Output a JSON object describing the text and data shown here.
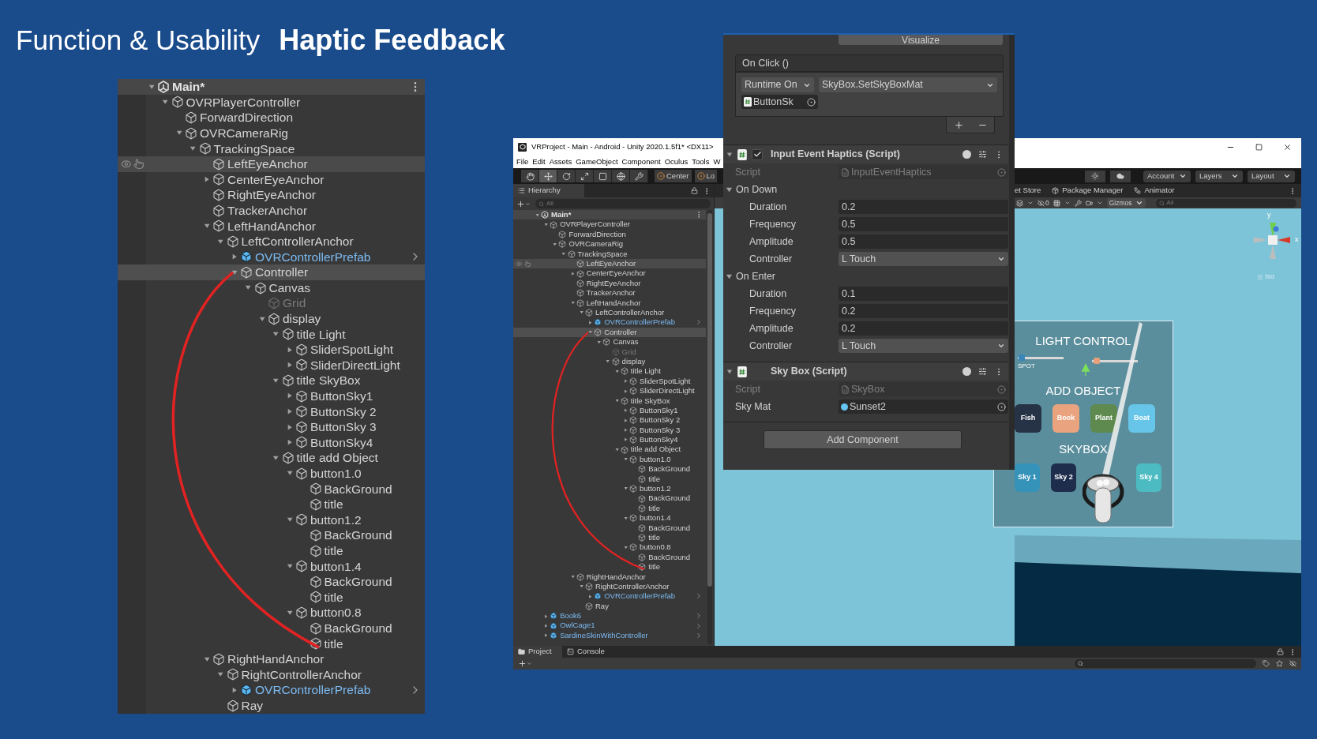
{
  "slide": {
    "title_light": "Function & Usability",
    "title_bold": "Haptic Feedback"
  },
  "zoomed_hierarchy": {
    "tree": [
      {
        "name": "Main*",
        "kind": "scene",
        "expanded": true,
        "children": [
          {
            "name": "OVRPlayerController",
            "kind": "object",
            "expanded": true,
            "selected": false,
            "children": [
              {
                "name": "ForwardDirection",
                "kind": "object",
                "selected": false
              },
              {
                "name": "OVRCameraRig",
                "kind": "object",
                "expanded": true,
                "selected": false,
                "children": [
                  {
                    "name": "TrackingSpace",
                    "kind": "object",
                    "expanded": true,
                    "selected": false,
                    "children": [
                      {
                        "name": "LeftEyeAnchor",
                        "kind": "object",
                        "selected": false,
                        "hovered": true
                      },
                      {
                        "name": "CenterEyeAnchor",
                        "kind": "object",
                        "expanded": false,
                        "selected": false
                      },
                      {
                        "name": "RightEyeAnchor",
                        "kind": "object",
                        "selected": false
                      },
                      {
                        "name": "TrackerAnchor",
                        "kind": "object",
                        "selected": false
                      },
                      {
                        "name": "LeftHandAnchor",
                        "kind": "object",
                        "expanded": true,
                        "selected": false,
                        "children": [
                          {
                            "name": "LeftControllerAnchor",
                            "kind": "object",
                            "expanded": true,
                            "selected": false,
                            "children": [
                              {
                                "name": "OVRControllerPrefab",
                                "kind": "prefab",
                                "expanded": false,
                                "selected": false
                              },
                              {
                                "name": "Controller",
                                "kind": "object",
                                "expanded": true,
                                "selected": true,
                                "children": [
                                  {
                                    "name": "Canvas",
                                    "kind": "object",
                                    "expanded": true,
                                    "selected": false,
                                    "children": [
                                      {
                                        "name": "Grid",
                                        "kind": "inactive",
                                        "selected": false
                                      },
                                      {
                                        "name": "display",
                                        "kind": "object",
                                        "expanded": true,
                                        "selected": false,
                                        "children": [
                                          {
                                            "name": "title Light",
                                            "kind": "object",
                                            "expanded": true,
                                            "selected": false,
                                            "children": [
                                              {
                                                "name": "SliderSpotLight",
                                                "kind": "object",
                                                "expanded": false,
                                                "selected": false
                                              },
                                              {
                                                "name": "SliderDirectLight",
                                                "kind": "object",
                                                "expanded": false,
                                                "selected": false
                                              }
                                            ]
                                          },
                                          {
                                            "name": "title SkyBox",
                                            "kind": "object",
                                            "expanded": true,
                                            "selected": false,
                                            "children": [
                                              {
                                                "name": "ButtonSky1",
                                                "kind": "object",
                                                "expanded": false,
                                                "selected": false
                                              },
                                              {
                                                "name": "ButtonSky 2",
                                                "kind": "object",
                                                "expanded": false,
                                                "selected": false
                                              },
                                              {
                                                "name": "ButtonSky 3",
                                                "kind": "object",
                                                "expanded": false,
                                                "selected": false
                                              },
                                              {
                                                "name": "ButtonSky4",
                                                "kind": "object",
                                                "expanded": false,
                                                "selected": false
                                              }
                                            ]
                                          },
                                          {
                                            "name": "title add Object",
                                            "kind": "object",
                                            "expanded": true,
                                            "selected": false,
                                            "children": [
                                              {
                                                "name": "button1.0",
                                                "kind": "object",
                                                "expanded": true,
                                                "selected": false,
                                                "children": [
                                                  {
                                                    "name": "BackGround",
                                                    "kind": "object",
                                                    "selected": false
                                                  },
                                                  {
                                                    "name": "title",
                                                    "kind": "object",
                                                    "selected": false
                                                  }
                                                ]
                                              },
                                              {
                                                "name": "button1.2",
                                                "kind": "object",
                                                "expanded": true,
                                                "selected": false,
                                                "children": [
                                                  {
                                                    "name": "BackGround",
                                                    "kind": "object",
                                                    "selected": false
                                                  },
                                                  {
                                                    "name": "title",
                                                    "kind": "object",
                                                    "selected": false
                                                  }
                                                ]
                                              },
                                              {
                                                "name": "button1.4",
                                                "kind": "object",
                                                "expanded": true,
                                                "selected": false,
                                                "children": [
                                                  {
                                                    "name": "BackGround",
                                                    "kind": "object",
                                                    "selected": false
                                                  },
                                                  {
                                                    "name": "title",
                                                    "kind": "object",
                                                    "selected": false
                                                  }
                                                ]
                                              },
                                              {
                                                "name": "button0.8",
                                                "kind": "object",
                                                "expanded": true,
                                                "selected": false,
                                                "children": [
                                                  {
                                                    "name": "BackGround",
                                                    "kind": "object",
                                                    "selected": false
                                                  },
                                                  {
                                                    "name": "title",
                                                    "kind": "object",
                                                    "selected": false
                                                  }
                                                ]
                                              }
                                            ]
                                          }
                                        ]
                                      }
                                    ]
                                  }
                                ]
                              }
                            ]
                          }
                        ]
                      },
                      {
                        "name": "RightHandAnchor",
                        "kind": "object",
                        "expanded": true,
                        "selected": false,
                        "children": [
                          {
                            "name": "RightControllerAnchor",
                            "kind": "object",
                            "expanded": true,
                            "selected": false,
                            "children": [
                              {
                                "name": "OVRControllerPrefab",
                                "kind": "prefab",
                                "expanded": false,
                                "selected": false
                              }
                            ]
                          },
                          {
                            "name": "Ray",
                            "kind": "object",
                            "selected": false
                          }
                        ]
                      }
                    ]
                  }
                ]
              }
            ]
          }
        ]
      }
    ]
  },
  "unity_window": {
    "title": "VRProject - Main - Android - Unity 2020.1.5f1* <DX11>",
    "menu": [
      "File",
      "Edit",
      "Assets",
      "GameObject",
      "Component",
      "Oculus",
      "Tools",
      "W"
    ],
    "tools": [
      {
        "kind": "hand",
        "selected": false
      },
      {
        "kind": "move",
        "selected": true
      },
      {
        "kind": "rotate",
        "selected": false
      },
      {
        "kind": "scale",
        "selected": false
      },
      {
        "kind": "rect",
        "selected": false
      },
      {
        "kind": "transform",
        "selected": false
      },
      {
        "kind": "custom",
        "selected": false
      }
    ],
    "pivot_buttons": [
      "Center",
      "Lo"
    ],
    "top_right_menus": [
      "Account",
      "Layers",
      "Layout"
    ],
    "scene_tabs": [
      "et Store",
      "Package Manager",
      "Animator"
    ],
    "scene_toolbar": {
      "hidden_count": "0",
      "gizmos": "Gizmos",
      "search_placeholder": "All"
    },
    "hierarchy": {
      "title": "Hierarchy",
      "search_placeholder": "All",
      "tree": [
        {
          "name": "Main*",
          "kind": "scene",
          "expanded": true,
          "children": [
            {
              "name": "OVRPlayerController",
              "kind": "object",
              "expanded": true,
              "selected": false,
              "children": [
                {
                  "name": "ForwardDirection",
                  "kind": "object",
                  "selected": false
                },
                {
                  "name": "OVRCameraRig",
                  "kind": "object",
                  "expanded": true,
                  "selected": false,
                  "children": [
                    {
                      "name": "TrackingSpace",
                      "kind": "object",
                      "expanded": true,
                      "selected": false,
                      "children": [
                        {
                          "name": "LeftEyeAnchor",
                          "kind": "object",
                          "selected": false,
                          "hovered": true
                        },
                        {
                          "name": "CenterEyeAnchor",
                          "kind": "object",
                          "expanded": false,
                          "selected": false
                        },
                        {
                          "name": "RightEyeAnchor",
                          "kind": "object",
                          "selected": false
                        },
                        {
                          "name": "TrackerAnchor",
                          "kind": "object",
                          "selected": false
                        },
                        {
                          "name": "LeftHandAnchor",
                          "kind": "object",
                          "expanded": true,
                          "selected": false,
                          "children": [
                            {
                              "name": "LeftControllerAnchor",
                              "kind": "object",
                              "expanded": true,
                              "selected": false,
                              "children": [
                                {
                                  "name": "OVRControllerPrefab",
                                  "kind": "prefab",
                                  "expanded": false,
                                  "selected": false
                                },
                                {
                                  "name": "Controller",
                                  "kind": "object",
                                  "expanded": true,
                                  "selected": true,
                                  "children": [
                                    {
                                      "name": "Canvas",
                                      "kind": "object",
                                      "expanded": true,
                                      "selected": false,
                                      "children": [
                                        {
                                          "name": "Grid",
                                          "kind": "inactive",
                                          "selected": false
                                        },
                                        {
                                          "name": "display",
                                          "kind": "object",
                                          "expanded": true,
                                          "selected": false,
                                          "children": [
                                            {
                                              "name": "title Light",
                                              "kind": "object",
                                              "expanded": true,
                                              "selected": false,
                                              "children": [
                                                {
                                                  "name": "SliderSpotLight",
                                                  "kind": "object",
                                                  "expanded": false,
                                                  "selected": false
                                                },
                                                {
                                                  "name": "SliderDirectLight",
                                                  "kind": "object",
                                                  "expanded": false,
                                                  "selected": false
                                                }
                                              ]
                                            },
                                            {
                                              "name": "title SkyBox",
                                              "kind": "object",
                                              "expanded": true,
                                              "selected": false,
                                              "children": [
                                                {
                                                  "name": "ButtonSky1",
                                                  "kind": "object",
                                                  "expanded": false,
                                                  "selected": false
                                                },
                                                {
                                                  "name": "ButtonSky 2",
                                                  "kind": "object",
                                                  "expanded": false,
                                                  "selected": false
                                                },
                                                {
                                                  "name": "ButtonSky 3",
                                                  "kind": "object",
                                                  "expanded": false,
                                                  "selected": false
                                                },
                                                {
                                                  "name": "ButtonSky4",
                                                  "kind": "object",
                                                  "expanded": false,
                                                  "selected": false
                                                }
                                              ]
                                            },
                                            {
                                              "name": "title add Object",
                                              "kind": "object",
                                              "expanded": true,
                                              "selected": false,
                                              "children": [
                                                {
                                                  "name": "button1.0",
                                                  "kind": "object",
                                                  "expanded": true,
                                                  "selected": false,
                                                  "children": [
                                                    {
                                                      "name": "BackGround",
                                                      "kind": "object",
                                                      "selected": false
                                                    },
                                                    {
                                                      "name": "title",
                                                      "kind": "object",
                                                      "selected": false
                                                    }
                                                  ]
                                                },
                                                {
                                                  "name": "button1.2",
                                                  "kind": "object",
                                                  "expanded": true,
                                                  "selected": false,
                                                  "children": [
                                                    {
                                                      "name": "BackGround",
                                                      "kind": "object",
                                                      "selected": false
                                                    },
                                                    {
                                                      "name": "title",
                                                      "kind": "object",
                                                      "selected": false
                                                    }
                                                  ]
                                                },
                                                {
                                                  "name": "button1.4",
                                                  "kind": "object",
                                                  "expanded": true,
                                                  "selected": false,
                                                  "children": [
                                                    {
                                                      "name": "BackGround",
                                                      "kind": "object",
                                                      "selected": false
                                                    },
                                                    {
                                                      "name": "title",
                                                      "kind": "object",
                                                      "selected": false
                                                    }
                                                  ]
                                                },
                                                {
                                                  "name": "button0.8",
                                                  "kind": "object",
                                                  "expanded": true,
                                                  "selected": false,
                                                  "children": [
                                                    {
                                                      "name": "BackGround",
                                                      "kind": "object",
                                                      "selected": false
                                                    },
                                                    {
                                                      "name": "title",
                                                      "kind": "object",
                                                      "selected": false
                                                    }
                                                  ]
                                                }
                                              ]
                                            }
                                          ]
                                        }
                                      ]
                                    }
                                  ]
                                }
                              ]
                            }
                          ]
                        },
                        {
                          "name": "RightHandAnchor",
                          "kind": "object",
                          "expanded": true,
                          "selected": false,
                          "children": [
                            {
                              "name": "RightControllerAnchor",
                              "kind": "object",
                              "expanded": true,
                              "selected": false,
                              "children": [
                                {
                                  "name": "OVRControllerPrefab",
                                  "kind": "prefab",
                                  "expanded": false,
                                  "selected": false
                                }
                              ]
                            },
                            {
                              "name": "Ray",
                              "kind": "object",
                              "selected": false
                            }
                          ]
                        }
                      ]
                    }
                  ]
                }
              ]
            },
            {
              "name": "Book6",
              "kind": "prefab",
              "expanded": false,
              "selected": false
            },
            {
              "name": "OwlCage1",
              "kind": "prefab",
              "expanded": false,
              "selected": false
            },
            {
              "name": "SardineSkinWithController",
              "kind": "prefab",
              "expanded": false,
              "selected": false
            }
          ]
        }
      ]
    },
    "scene": {
      "gizmo_labels": [
        "y",
        "x"
      ],
      "view_mode": "Iso",
      "panel": {
        "light_title": "LIGHT CONTROL",
        "sliders": [
          {
            "label": "SPOT",
            "level": 0.02
          },
          {
            "level": 0.03
          }
        ],
        "object_title": "ADD OBJECT",
        "object_tiles": [
          {
            "label": "Fish",
            "color": "#263246"
          },
          {
            "label": "Book",
            "color": "#e9a37e"
          },
          {
            "label": "Plant",
            "color": "#5e8a4f"
          },
          {
            "label": "Boat",
            "color": "#66c5e8"
          }
        ],
        "skybox_title": "SKYBOX",
        "sky_tiles": [
          {
            "label": "Sky 1",
            "color": "#3592b8"
          },
          {
            "label": "Sky 2",
            "color": "#1f2d4d"
          },
          {
            "label": "Sky 4",
            "color": "#4dbcc2"
          }
        ]
      }
    },
    "bottom_tabs": [
      {
        "label": "Project",
        "selected": true
      },
      {
        "label": "Console",
        "selected": false
      }
    ]
  },
  "inspector": {
    "visualize": "Visualize",
    "event": {
      "title": "On Click ()",
      "mode": "Runtime On",
      "function": "SkyBox.SetSkyBoxMat",
      "target": "ButtonSk"
    },
    "components": [
      {
        "title": "Input Event Haptics (Script)",
        "enabled": true,
        "script_label": "Script",
        "script": "InputEventHaptics",
        "groups": [
          {
            "title": "On Down",
            "expanded": true,
            "fields": [
              {
                "label": "Duration",
                "value": "0.2",
                "kind": "number"
              },
              {
                "label": "Frequency",
                "value": "0.5",
                "kind": "number"
              },
              {
                "label": "Amplitude",
                "value": "0.5",
                "kind": "number"
              },
              {
                "label": "Controller",
                "value": "L Touch",
                "kind": "dropdown"
              }
            ]
          },
          {
            "title": "On Enter",
            "expanded": true,
            "fields": [
              {
                "label": "Duration",
                "value": "0.1",
                "kind": "number"
              },
              {
                "label": "Frequency",
                "value": "0.2",
                "kind": "number"
              },
              {
                "label": "Amplitude",
                "value": "0.2",
                "kind": "number"
              },
              {
                "label": "Controller",
                "value": "L Touch",
                "kind": "dropdown"
              }
            ]
          }
        ]
      },
      {
        "title": "Sky Box (Script)",
        "script_label": "Script",
        "script": "SkyBox",
        "fields": [
          {
            "label": "Sky Mat",
            "value": "Sunset2",
            "kind": "object"
          }
        ]
      }
    ],
    "add_component": "Add Component"
  }
}
